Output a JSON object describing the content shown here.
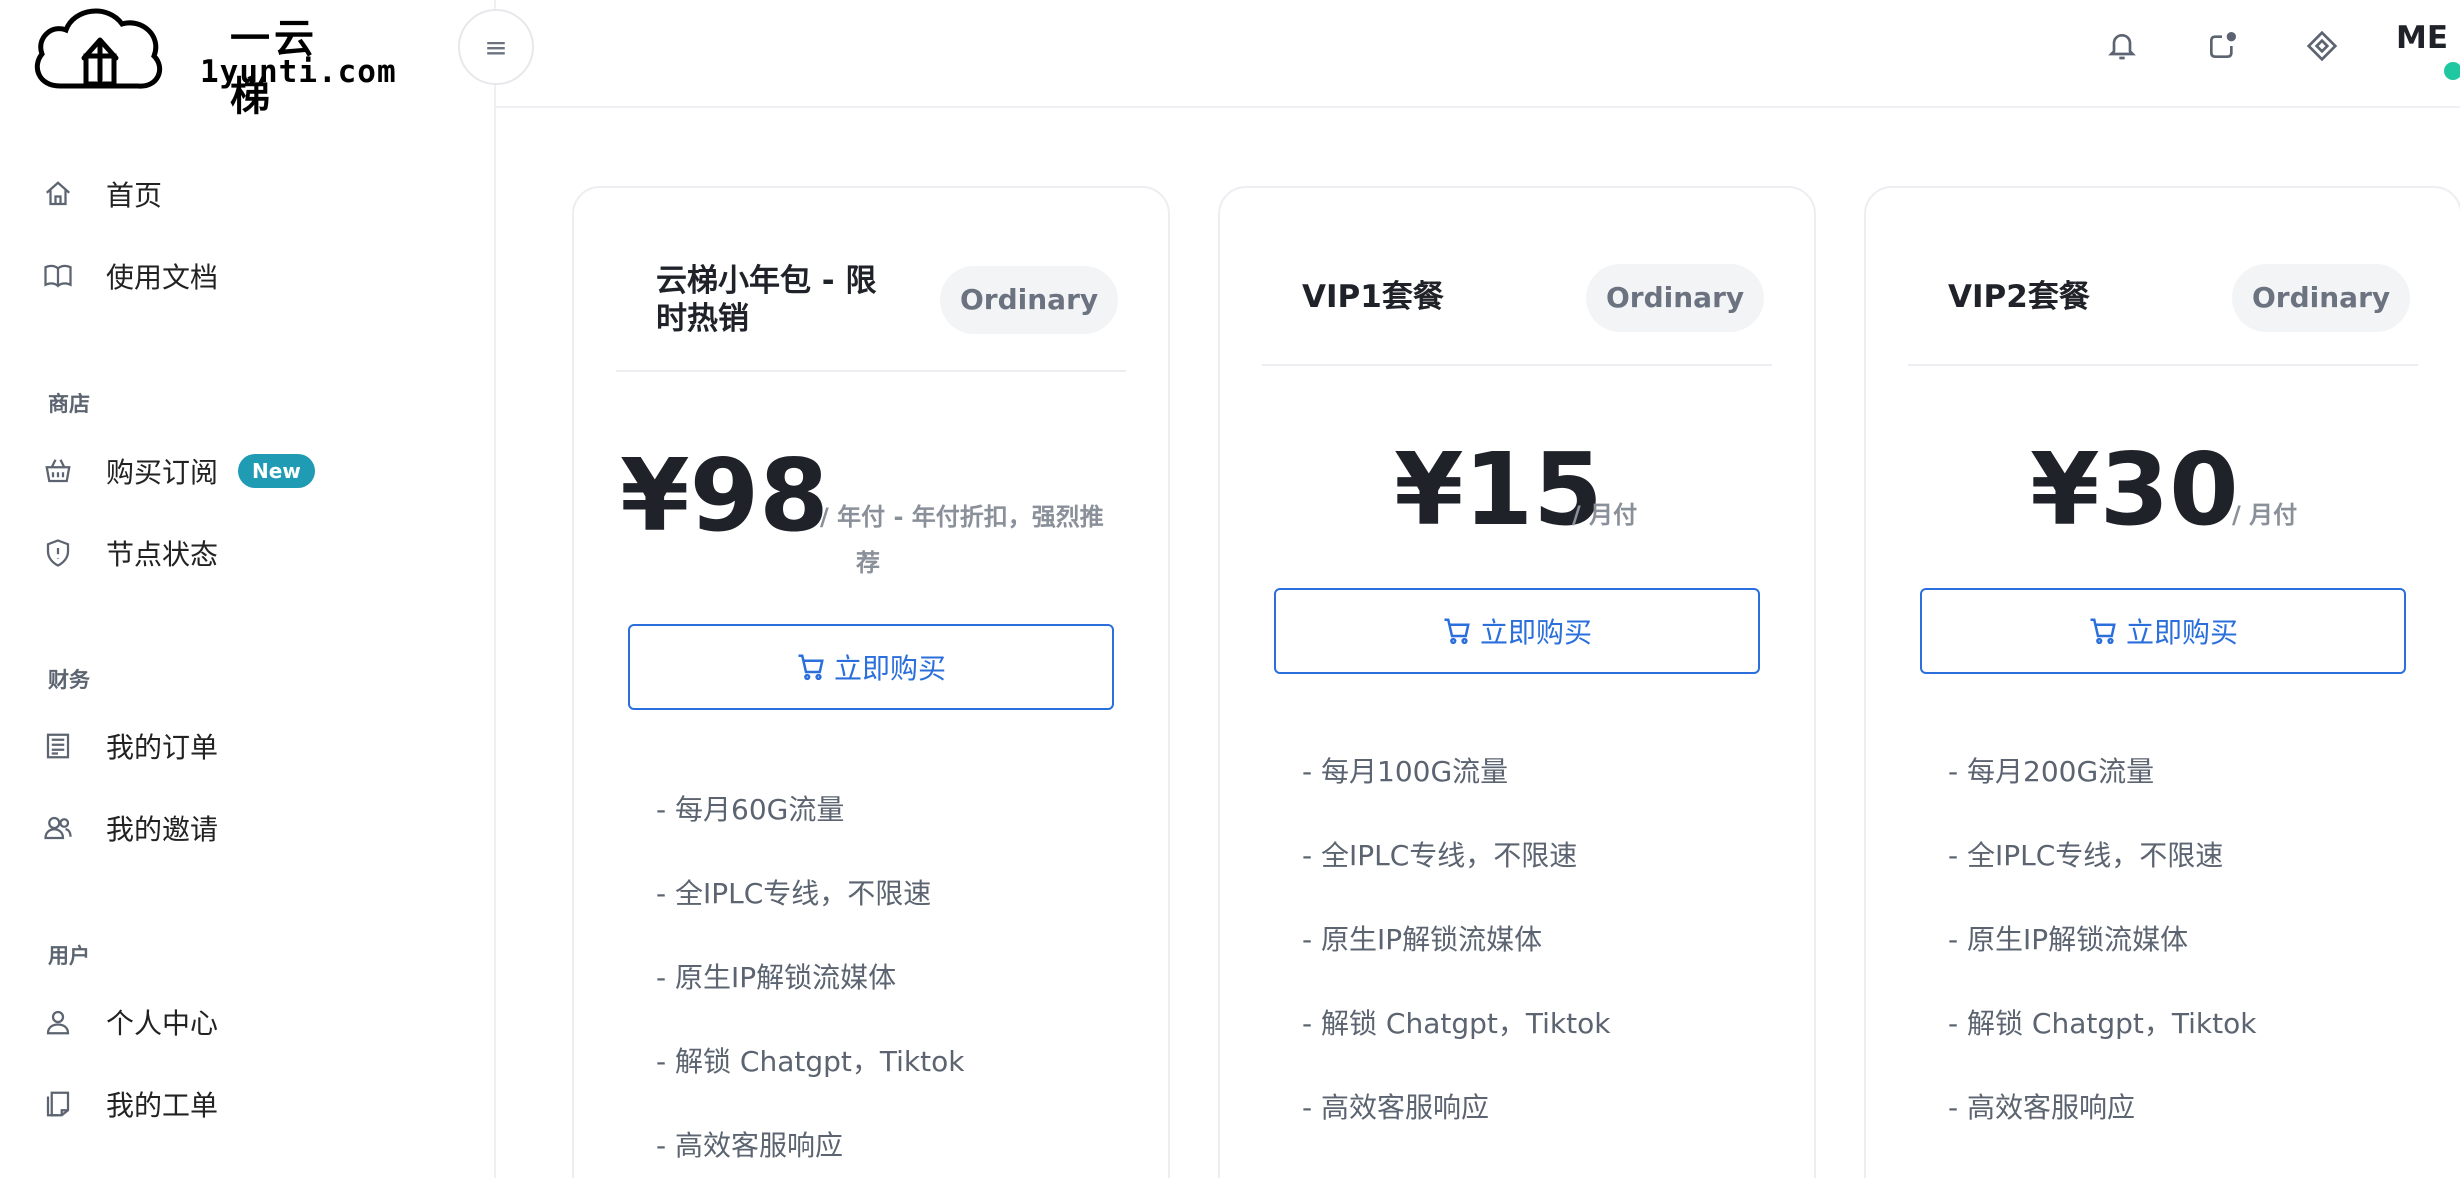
{
  "logo": {
    "cn": "一云梯",
    "en": "1yunti.com"
  },
  "sidebar": {
    "top_items": [
      {
        "label": "首页",
        "icon": "home-icon"
      },
      {
        "label": "使用文档",
        "icon": "book-icon"
      }
    ],
    "sections": [
      {
        "title": "商店",
        "items": [
          {
            "label": "购买订阅",
            "icon": "basket-icon",
            "badge": "New"
          },
          {
            "label": "节点状态",
            "icon": "shield-icon"
          }
        ]
      },
      {
        "title": "财务",
        "items": [
          {
            "label": "我的订单",
            "icon": "receipt-icon"
          },
          {
            "label": "我的邀请",
            "icon": "users-icon"
          }
        ]
      },
      {
        "title": "用户",
        "items": [
          {
            "label": "个人中心",
            "icon": "user-icon"
          },
          {
            "label": "我的工单",
            "icon": "ticket-icon"
          }
        ]
      }
    ]
  },
  "header": {
    "menu_icon": "≡",
    "icons": [
      "bell-icon",
      "notification-icon",
      "diamond-icon"
    ],
    "avatar": "ME",
    "status_color": "#1fc8a0"
  },
  "plans": [
    {
      "title": "云梯小年包 - 限时热销",
      "title_lines": [
        "云梯小年包 - 限",
        "时热销"
      ],
      "badge": "Ordinary",
      "price": "¥98",
      "period": "/ 年付 - 年付折扣，强烈推荐",
      "period_lines": [
        "/ 年付 - 年付折扣，强烈推",
        "荐"
      ],
      "button": "立即购买",
      "features": [
        "- 每月60G流量",
        "- 全IPLC专线，不限速",
        "- 原生IP解锁流媒体",
        "- 解锁 Chatgpt，Tiktok",
        "- 高效客服响应"
      ]
    },
    {
      "title": "VIP1套餐",
      "badge": "Ordinary",
      "price": "¥15",
      "period": "/ 月付",
      "button": "立即购买",
      "features": [
        "- 每月100G流量",
        "- 全IPLC专线，不限速",
        "- 原生IP解锁流媒体",
        "- 解锁 Chatgpt，Tiktok",
        "- 高效客服响应"
      ]
    },
    {
      "title": "VIP2套餐",
      "badge": "Ordinary",
      "price": "¥30",
      "period": "/ 月付",
      "button": "立即购买",
      "features": [
        "- 每月200G流量",
        "- 全IPLC专线，不限速",
        "- 原生IP解锁流媒体",
        "- 解锁 Chatgpt，Tiktok",
        "- 高效客服响应"
      ]
    }
  ],
  "colors": {
    "accent": "#2a6fdb",
    "new_badge": "#1f9bb3"
  }
}
